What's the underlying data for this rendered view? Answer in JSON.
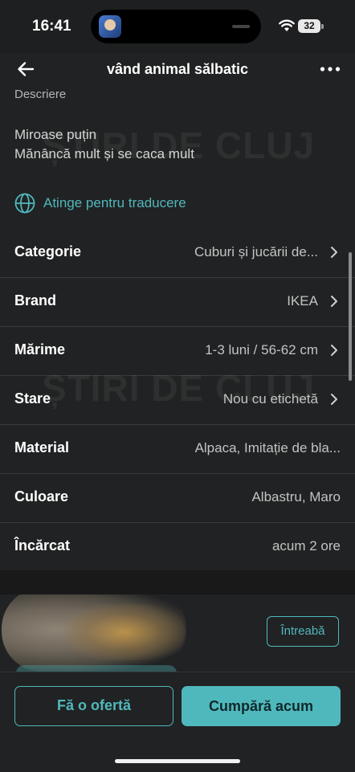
{
  "status_bar": {
    "time": "16:41",
    "battery": "32"
  },
  "header": {
    "title": "vând animal sălbatic",
    "back_icon": "arrow-left-icon",
    "more_icon": "more-horizontal-icon"
  },
  "description": {
    "label": "Descriere",
    "lines": [
      "Miroase puțin",
      "Mănâncă mult și se caca mult"
    ],
    "watermark": "ȘTIRI DE CLUJ"
  },
  "translate": {
    "label": "Atinge pentru traducere",
    "icon": "globe-icon"
  },
  "details": [
    {
      "label": "Categorie",
      "value": "Cuburi și jucării de...",
      "chevron": true
    },
    {
      "label": "Brand",
      "value": "IKEA",
      "chevron": true
    },
    {
      "label": "Mărime",
      "value": "1-3 luni / 56-62 cm",
      "chevron": true
    },
    {
      "label": "Stare",
      "value": "Nou cu etichetă",
      "chevron": true
    },
    {
      "label": "Material",
      "value": "Alpaca, Imitație de bla...",
      "chevron": false
    },
    {
      "label": "Culoare",
      "value": "Albastru, Maro",
      "chevron": false
    },
    {
      "label": "Încărcat",
      "value": "acum 2 ore",
      "chevron": false
    }
  ],
  "seller": {
    "ask_label": "Întreabă"
  },
  "actions": {
    "offer_label": "Fă o ofertă",
    "buy_label": "Cumpără acum"
  },
  "colors": {
    "accent": "#4fb8bd",
    "background": "#212223"
  }
}
